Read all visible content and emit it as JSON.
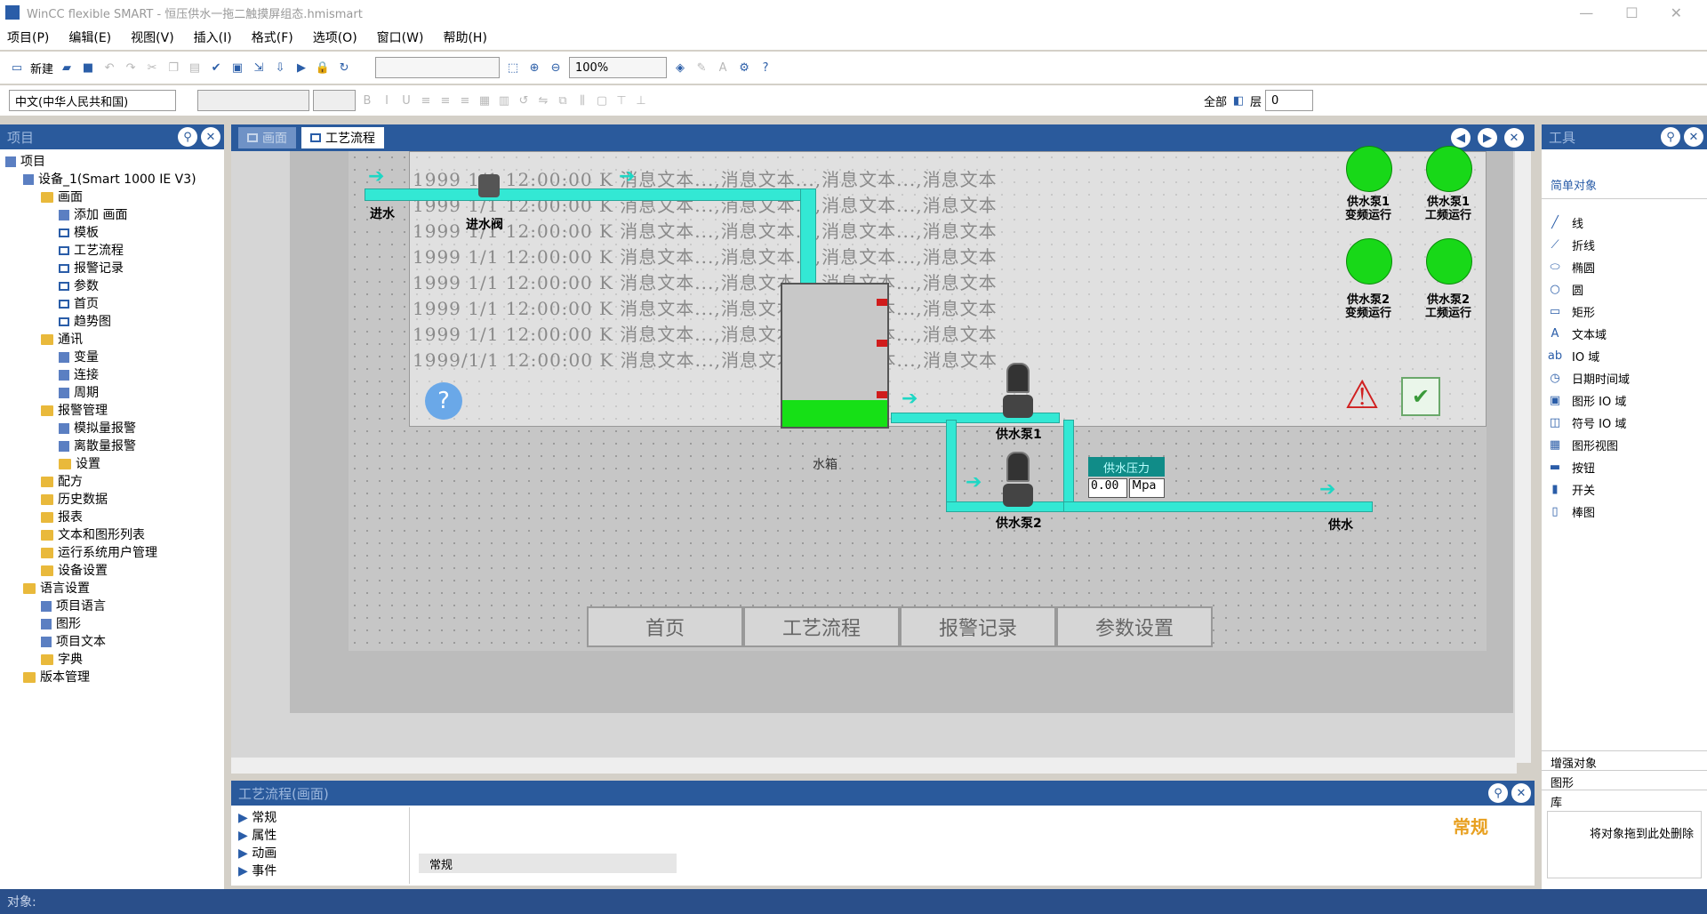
{
  "window": {
    "title": "WinCC flexible SMART - 恒压供水一拖二触摸屏组态.hmismart"
  },
  "menu": [
    "项目(P)",
    "编辑(E)",
    "视图(V)",
    "插入(I)",
    "格式(F)",
    "选项(O)",
    "窗口(W)",
    "帮助(H)"
  ],
  "toolbar": {
    "new_label": "新建",
    "zoom": "100%",
    "lang": "中文(中华人民共和国)",
    "all_label": "全部",
    "layer_label": "层",
    "layer_value": "0"
  },
  "project": {
    "header": "项目",
    "tree": [
      {
        "t": "项目",
        "lvl": 0,
        "ic": "g"
      },
      {
        "t": "设备_1(Smart 1000 IE V3)",
        "lvl": 1,
        "ic": "g"
      },
      {
        "t": "画面",
        "lvl": 2,
        "ic": "f"
      },
      {
        "t": "添加 画面",
        "lvl": 3,
        "ic": "g"
      },
      {
        "t": "模板",
        "lvl": 3,
        "ic": "p"
      },
      {
        "t": "工艺流程",
        "lvl": 3,
        "ic": "p"
      },
      {
        "t": "报警记录",
        "lvl": 3,
        "ic": "p"
      },
      {
        "t": "参数",
        "lvl": 3,
        "ic": "p"
      },
      {
        "t": "首页",
        "lvl": 3,
        "ic": "p"
      },
      {
        "t": "趋势图",
        "lvl": 3,
        "ic": "p"
      },
      {
        "t": "通讯",
        "lvl": 2,
        "ic": "f"
      },
      {
        "t": "变量",
        "lvl": 3,
        "ic": "g"
      },
      {
        "t": "连接",
        "lvl": 3,
        "ic": "g"
      },
      {
        "t": "周期",
        "lvl": 3,
        "ic": "g"
      },
      {
        "t": "报警管理",
        "lvl": 2,
        "ic": "f"
      },
      {
        "t": "模拟量报警",
        "lvl": 3,
        "ic": "g"
      },
      {
        "t": "离散量报警",
        "lvl": 3,
        "ic": "g"
      },
      {
        "t": "设置",
        "lvl": 3,
        "ic": "f"
      },
      {
        "t": "配方",
        "lvl": 2,
        "ic": "f"
      },
      {
        "t": "历史数据",
        "lvl": 2,
        "ic": "f"
      },
      {
        "t": "报表",
        "lvl": 2,
        "ic": "f"
      },
      {
        "t": "文本和图形列表",
        "lvl": 2,
        "ic": "f"
      },
      {
        "t": "运行系统用户管理",
        "lvl": 2,
        "ic": "f"
      },
      {
        "t": "设备设置",
        "lvl": 2,
        "ic": "f"
      },
      {
        "t": "语言设置",
        "lvl": 1,
        "ic": "f"
      },
      {
        "t": "项目语言",
        "lvl": 2,
        "ic": "g"
      },
      {
        "t": "图形",
        "lvl": 2,
        "ic": "g"
      },
      {
        "t": "项目文本",
        "lvl": 2,
        "ic": "g"
      },
      {
        "t": "字典",
        "lvl": 2,
        "ic": "f"
      },
      {
        "t": "版本管理",
        "lvl": 1,
        "ic": "f"
      }
    ]
  },
  "tabs": {
    "first": "画面",
    "active": "工艺流程"
  },
  "screen": {
    "alarm_lines": [
      "1999 1/1 12:00:00 K 消息文本...,消息文本...,消息文本...,消息文本",
      "1999 1/1 12:00:00 K 消息文本...,消息文本...,消息文本...,消息文本",
      "1999 1/1 12:00:00 K 消息文本...,消息文本...,消息文本...,消息文本",
      "1999 1/1 12:00:00 K 消息文本...,消息文本...,消息文本...,消息文本",
      "1999 1/1 12:00:00 K 消息文本...,消息文本...,消息文本...,消息文本",
      "1999 1/1 12:00:00 K 消息文本...,消息文本...,消息文本...,消息文本",
      "1999 1/1 12:00:00 K 消息文本...,消息文本...,消息文本...,消息文本",
      "1999/1/1 12:00:00 K 消息文本...,消息文本...,消息文本...,消息文本"
    ],
    "inlet": "进水",
    "valve": "进水阀",
    "tank": "水箱",
    "pump1": "供水泵1",
    "pump2": "供水泵2",
    "outlet": "供水",
    "pressure_title": "供水压力",
    "pressure_value": "0.00",
    "pressure_unit": "Mpa",
    "lamps": [
      "供水泵1\n变频运行",
      "供水泵1\n工频运行",
      "供水泵2\n变频运行",
      "供水泵2\n工频运行"
    ],
    "nav": [
      "首页",
      "工艺流程",
      "报警记录",
      "参数设置"
    ]
  },
  "properties": {
    "header": "工艺流程(画面)",
    "items": [
      "常规",
      "属性",
      "动画",
      "事件"
    ],
    "general_title": "常规",
    "sub_header": "常规"
  },
  "tools": {
    "header": "工具",
    "section": "简单对象",
    "items": [
      "线",
      "折线",
      "椭圆",
      "圆",
      "矩形",
      "文本域",
      "IO 域",
      "日期时间域",
      "图形 IO 域",
      "符号 IO 域",
      "图形视图",
      "按钮",
      "开关",
      "棒图"
    ],
    "bottom": [
      "增强对象",
      "图形",
      "库"
    ],
    "hint": "将对象拖到此处删除"
  },
  "status": {
    "label": "对象:"
  }
}
